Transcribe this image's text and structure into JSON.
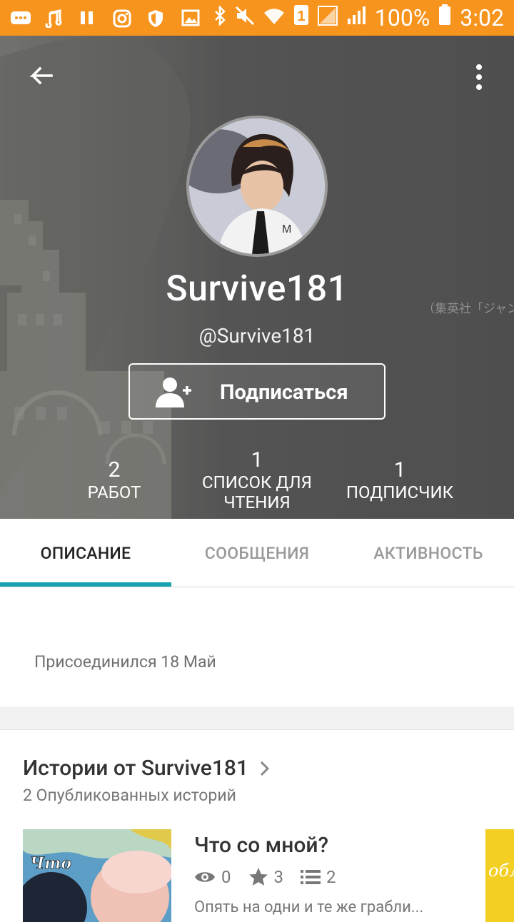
{
  "status_bar": {
    "battery_percent": "100%",
    "time": "3:02",
    "sim_slot": "1"
  },
  "profile": {
    "display_name": "Survive181",
    "handle": "@Survive181",
    "follow_button_label": "Подписаться",
    "background_caption": "（集英社「ジャンプ",
    "stats": [
      {
        "value": "2",
        "label": "РАБОТ"
      },
      {
        "value": "1",
        "label_line1": "СПИСОК ДЛЯ",
        "label_line2": "ЧТЕНИЯ"
      },
      {
        "value": "1",
        "label": "ПОДПИСЧИК"
      }
    ]
  },
  "tabs": [
    {
      "label": "ОПИСАНИЕ",
      "active": true
    },
    {
      "label": "СООБЩЕНИЯ",
      "active": false
    },
    {
      "label": "АКТИВНОСТЬ",
      "active": false
    }
  ],
  "description": {
    "joined": "Присоединился 18 Май"
  },
  "stories": {
    "title": "Истории от Survive181",
    "subtitle": "2 Опубликованных историй",
    "items": [
      {
        "title": "Что со мной?",
        "cover_text": "Что",
        "views": "0",
        "votes": "3",
        "parts": "2",
        "description": "Опять на одни и те же грабли..."
      },
      {
        "cover_text": "обл"
      }
    ]
  },
  "colors": {
    "status_bar": "#f7941d",
    "tab_indicator": "#16a3b1",
    "header_overlay": "#575757"
  },
  "icons": {
    "back": "arrow-left-icon",
    "menu": "more-vertical-icon",
    "follow": "person-add-icon",
    "views": "eye-icon",
    "votes": "star-icon",
    "parts": "list-icon",
    "chevron": "chevron-right-icon"
  }
}
